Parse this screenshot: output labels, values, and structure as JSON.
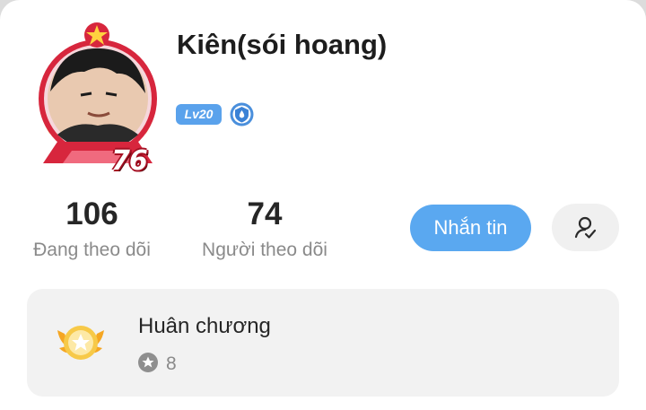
{
  "profile": {
    "name": "Kiên(sói hoang)",
    "frame_level": "76",
    "level_badge": "Lv20",
    "verified_icon": "shield-drop-icon"
  },
  "stats": {
    "following": {
      "value": "106",
      "label": "Đang theo dõi"
    },
    "followers": {
      "value": "74",
      "label": "Người theo dõi"
    }
  },
  "actions": {
    "message_label": "Nhắn tin",
    "follow_icon": "user-check-icon"
  },
  "medals": {
    "title": "Huân chương",
    "count": "8",
    "icon": "winged-medal-icon",
    "count_icon": "star-badge-icon"
  },
  "colors": {
    "accent": "#5aa8f0",
    "level_badge": "#5aa2ec",
    "frame_red": "#c8102e",
    "medal_gold": "#f5b730"
  }
}
